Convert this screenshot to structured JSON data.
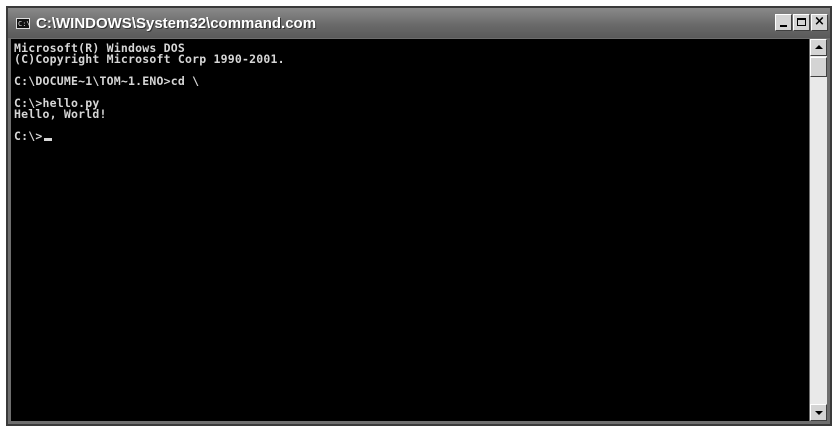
{
  "window": {
    "title": "C:\\WINDOWS\\System32\\command.com",
    "icon": "ms-dos-console-icon",
    "icon_text": "C:\\"
  },
  "console": {
    "lines": [
      "Microsoft(R) Windows DOS",
      "(C)Copyright Microsoft Corp 1990-2001.",
      "",
      "C:\\DOCUME~1\\TOM~1.ENO>cd \\",
      "",
      "C:\\>hello.py",
      "Hello, World!",
      "",
      "C:\\>"
    ]
  },
  "colors": {
    "titlebar": "#6a6a6a",
    "console_background": "#000000",
    "console_text": "#d6d6d6"
  }
}
